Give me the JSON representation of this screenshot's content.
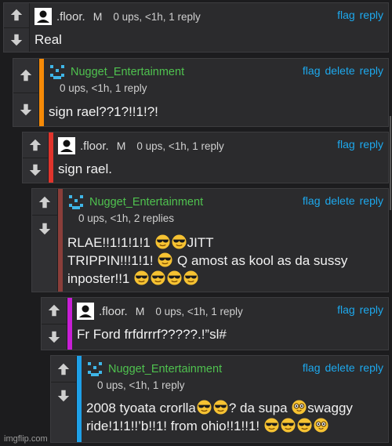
{
  "colors": {
    "accent_link": "#1da9ee",
    "username_green": "#4fc24f",
    "bar_orange": "#f58a07",
    "bar_red": "#e0342c",
    "bar_maroon": "#8a3e3a",
    "bar_magenta": "#c81fd6",
    "bar_blue": "#1ea0e8"
  },
  "icons": {
    "upvote": "arrow-up-icon",
    "downvote": "arrow-down-icon",
    "emoji_cool": "sunglasses-emoji-icon",
    "emoji_nerd": "nerd-face-emoji-icon"
  },
  "comments": [
    {
      "user": ".floor.",
      "mod": "M",
      "meta": "0 ups, <1h, 1 reply",
      "flag": "flag",
      "reply": "reply",
      "body": "Real"
    },
    {
      "user": "Nugget_Entertainment",
      "meta": "0 ups, <1h, 1 reply",
      "flag": "flag",
      "delete": "delete",
      "reply": "reply",
      "body": "sign rael??1?!!1!?!"
    },
    {
      "user": ".floor.",
      "mod": "M",
      "meta": "0 ups, <1h, 1 reply",
      "flag": "flag",
      "reply": "reply",
      "body": "sign rael."
    },
    {
      "user": "Nugget_Entertainment",
      "meta": "0 ups, <1h, 2 replies",
      "flag": "flag",
      "delete": "delete",
      "reply": "reply",
      "body_parts": [
        "RLAE!!1!1!1!1 ",
        "JITT",
        "TRIPPIN!!!1!1! ",
        " Q amost as kool as da sussy",
        "inposter!!1 "
      ]
    },
    {
      "user": ".floor.",
      "mod": "M",
      "meta": "0 ups, <1h, 1 reply",
      "flag": "flag",
      "reply": "reply",
      "body": "Fr Ford frfdrrrf?????.!”sl#"
    },
    {
      "user": "Nugget_Entertainment",
      "meta": "0 ups, <1h, 1 reply",
      "flag": "flag",
      "delete": "delete",
      "reply": "reply",
      "body_parts": [
        "2008 tyoata crorlla",
        "? da supa ",
        "swaggy",
        "ride!1!1!!’b!!1! from ohio!!1!!1! "
      ]
    }
  ],
  "watermark": "imgflip.com"
}
